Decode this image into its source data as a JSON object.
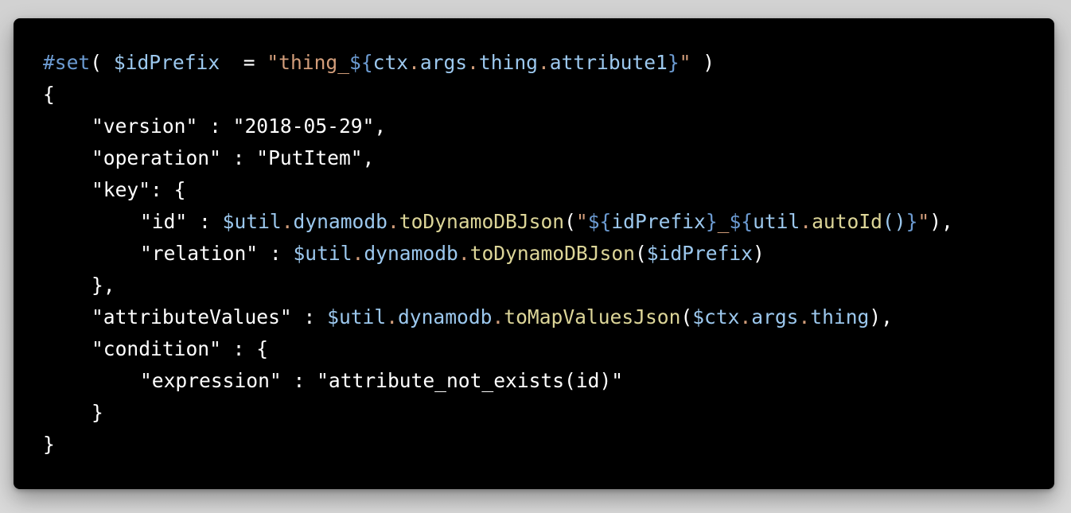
{
  "colors": {
    "background": "#d6d6d6",
    "editor_background": "#000000",
    "plain": "#ffffff",
    "directive": "#6c9bd2",
    "variable": "#9cc8ee",
    "string": "#d29d7a",
    "function": "#dcd598"
  },
  "code_lines": [
    {
      "indent": 0,
      "tokens": [
        {
          "t": "#set",
          "k": "directive"
        },
        {
          "t": "( ",
          "k": "plain"
        },
        {
          "t": "$idPrefix",
          "k": "var"
        },
        {
          "t": "  = ",
          "k": "plain"
        },
        {
          "t": "\"thing_",
          "k": "str"
        },
        {
          "t": "${",
          "k": "interp"
        },
        {
          "t": "ctx",
          "k": "var"
        },
        {
          "t": ".",
          "k": "dot"
        },
        {
          "t": "args",
          "k": "var"
        },
        {
          "t": ".",
          "k": "dot"
        },
        {
          "t": "thing",
          "k": "var"
        },
        {
          "t": ".",
          "k": "dot"
        },
        {
          "t": "attribute1",
          "k": "var"
        },
        {
          "t": "}",
          "k": "interp"
        },
        {
          "t": "\"",
          "k": "str"
        },
        {
          "t": " )",
          "k": "plain"
        }
      ]
    },
    {
      "indent": 0,
      "tokens": [
        {
          "t": "{",
          "k": "plain"
        }
      ]
    },
    {
      "indent": 1,
      "tokens": [
        {
          "t": "\"version\" : \"2018-05-29\",",
          "k": "plain"
        }
      ]
    },
    {
      "indent": 1,
      "tokens": [
        {
          "t": "\"operation\" : \"PutItem\",",
          "k": "plain"
        }
      ]
    },
    {
      "indent": 1,
      "tokens": [
        {
          "t": "\"key\": {",
          "k": "plain"
        }
      ]
    },
    {
      "indent": 2,
      "tokens": [
        {
          "t": "\"id\" : ",
          "k": "plain"
        },
        {
          "t": "$util",
          "k": "var"
        },
        {
          "t": ".",
          "k": "dot"
        },
        {
          "t": "dynamodb",
          "k": "var"
        },
        {
          "t": ".",
          "k": "dot"
        },
        {
          "t": "toDynamoDBJson",
          "k": "fn"
        },
        {
          "t": "(",
          "k": "plain"
        },
        {
          "t": "\"",
          "k": "str"
        },
        {
          "t": "${",
          "k": "interp"
        },
        {
          "t": "idPrefix",
          "k": "var"
        },
        {
          "t": "}",
          "k": "interp"
        },
        {
          "t": "_",
          "k": "str"
        },
        {
          "t": "${",
          "k": "interp"
        },
        {
          "t": "util",
          "k": "var"
        },
        {
          "t": ".",
          "k": "dot"
        },
        {
          "t": "autoId",
          "k": "fn"
        },
        {
          "t": "()",
          "k": "var"
        },
        {
          "t": "}",
          "k": "interp"
        },
        {
          "t": "\"",
          "k": "str"
        },
        {
          "t": "),",
          "k": "plain"
        }
      ]
    },
    {
      "indent": 2,
      "tokens": [
        {
          "t": "\"relation\" : ",
          "k": "plain"
        },
        {
          "t": "$util",
          "k": "var"
        },
        {
          "t": ".",
          "k": "dot"
        },
        {
          "t": "dynamodb",
          "k": "var"
        },
        {
          "t": ".",
          "k": "dot"
        },
        {
          "t": "toDynamoDBJson",
          "k": "fn"
        },
        {
          "t": "(",
          "k": "plain"
        },
        {
          "t": "$idPrefix",
          "k": "var"
        },
        {
          "t": ")",
          "k": "plain"
        }
      ]
    },
    {
      "indent": 1,
      "tokens": [
        {
          "t": "},",
          "k": "plain"
        }
      ]
    },
    {
      "indent": 1,
      "tokens": [
        {
          "t": "\"attributeValues\" : ",
          "k": "plain"
        },
        {
          "t": "$util",
          "k": "var"
        },
        {
          "t": ".",
          "k": "dot"
        },
        {
          "t": "dynamodb",
          "k": "var"
        },
        {
          "t": ".",
          "k": "dot"
        },
        {
          "t": "toMapValuesJson",
          "k": "fn"
        },
        {
          "t": "(",
          "k": "plain"
        },
        {
          "t": "$ctx",
          "k": "var"
        },
        {
          "t": ".",
          "k": "dot"
        },
        {
          "t": "args",
          "k": "var"
        },
        {
          "t": ".",
          "k": "dot"
        },
        {
          "t": "thing",
          "k": "var"
        },
        {
          "t": "),",
          "k": "plain"
        }
      ]
    },
    {
      "indent": 1,
      "tokens": [
        {
          "t": "\"condition\" : {",
          "k": "plain"
        }
      ]
    },
    {
      "indent": 2,
      "tokens": [
        {
          "t": "\"expression\" : \"attribute_not_exists(id)\"",
          "k": "plain"
        }
      ]
    },
    {
      "indent": 1,
      "tokens": [
        {
          "t": "}",
          "k": "plain"
        }
      ]
    },
    {
      "indent": 0,
      "tokens": [
        {
          "t": "}",
          "k": "plain"
        }
      ]
    }
  ]
}
